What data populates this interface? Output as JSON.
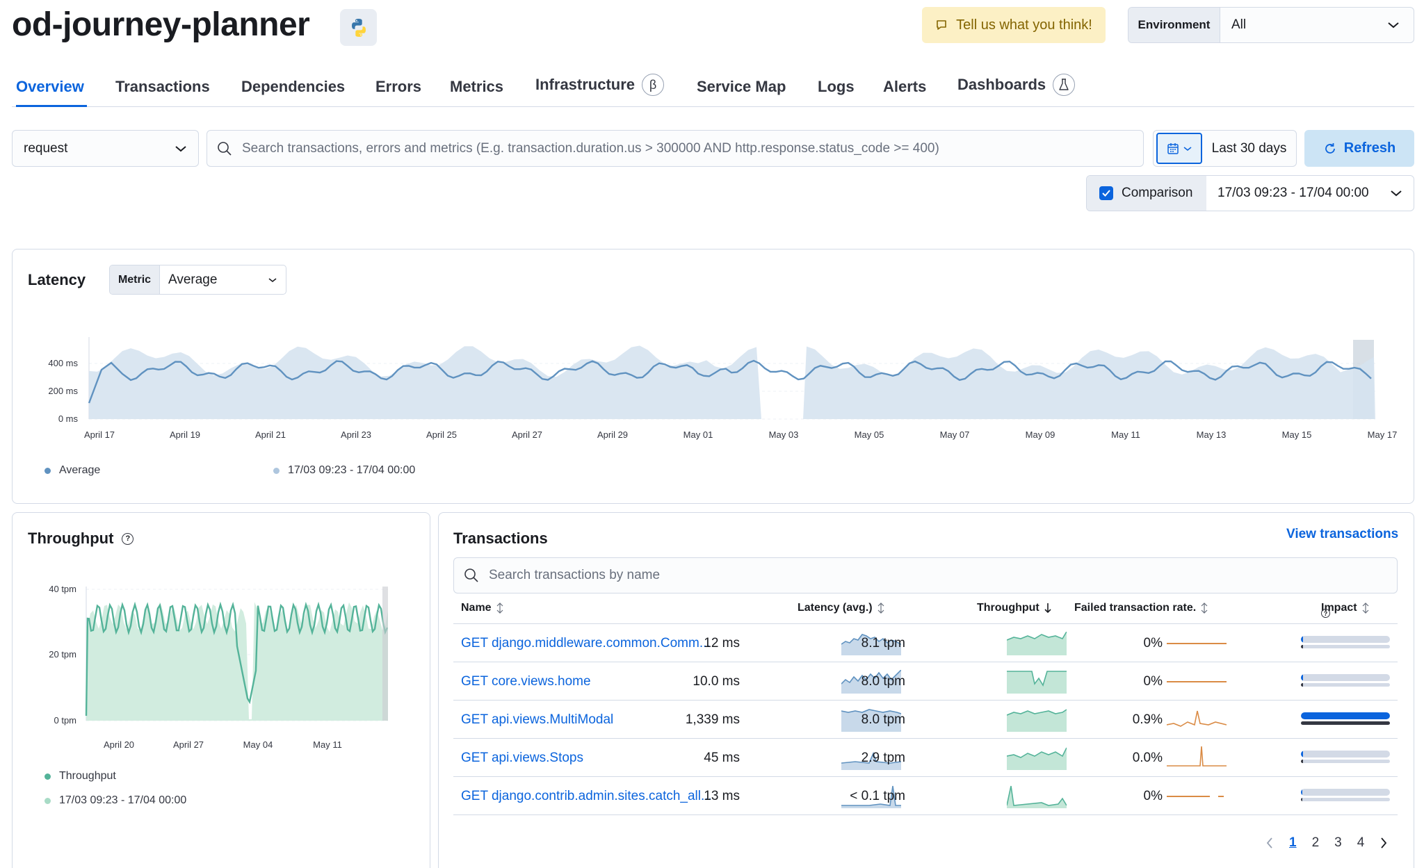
{
  "header": {
    "service_name": "od-journey-planner",
    "python_icon": "python-logo-icon",
    "feedback_label": "Tell us what you think!",
    "environment_label": "Environment",
    "environment_value": "All"
  },
  "tabs": [
    {
      "label": "Overview",
      "active": true
    },
    {
      "label": "Transactions"
    },
    {
      "label": "Dependencies"
    },
    {
      "label": "Errors"
    },
    {
      "label": "Metrics"
    },
    {
      "label": "Infrastructure",
      "badge": "β"
    },
    {
      "label": "Service Map"
    },
    {
      "label": "Logs"
    },
    {
      "label": "Alerts"
    },
    {
      "label": "Dashboards",
      "badge_icon": "flask-icon"
    }
  ],
  "filters": {
    "transaction_type": "request",
    "search_placeholder": "Search transactions, errors and metrics (E.g. transaction.duration.us > 300000 AND http.response.status_code >= 400)",
    "date_range": "Last 30 days",
    "refresh_label": "Refresh",
    "comparison_label": "Comparison",
    "comparison_checked": true,
    "comparison_range": "17/03 09:23 - 17/04 00:00"
  },
  "latency": {
    "title": "Latency",
    "metric_label": "Metric",
    "metric_value": "Average",
    "y_ticks": [
      "0 ms",
      "200 ms",
      "400 ms"
    ],
    "x_ticks": [
      "April 17",
      "April 19",
      "April 21",
      "April 23",
      "April 25",
      "April 27",
      "April 29",
      "May 01",
      "May 03",
      "May 05",
      "May 07",
      "May 09",
      "May 11",
      "May 13",
      "May 15",
      "May 17"
    ],
    "legend": [
      "Average",
      "17/03 09:23 - 17/04 00:00"
    ],
    "colors": {
      "primary": "#6092c0",
      "comparison": "#d6e3f0"
    }
  },
  "throughput": {
    "title": "Throughput",
    "y_ticks": [
      "0 tpm",
      "20 tpm",
      "40 tpm"
    ],
    "x_ticks": [
      "April 20",
      "April 27",
      "May 04",
      "May 11"
    ],
    "legend": [
      "Throughput",
      "17/03 09:23 - 17/04 00:00"
    ],
    "colors": {
      "primary": "#54b399",
      "comparison": "#d1ecdf"
    }
  },
  "transactions": {
    "title": "Transactions",
    "view_link": "View transactions",
    "search_placeholder": "Search transactions by name",
    "columns": {
      "name": "Name",
      "latency": "Latency (avg.)",
      "throughput": "Throughput",
      "failed": "Failed transaction rate.",
      "impact": "Impact"
    },
    "rows": [
      {
        "name": "GET django.middleware.common.Comm...",
        "latency": "12 ms",
        "throughput": "8.1 tpm",
        "failed": "0%",
        "impact": 0.02
      },
      {
        "name": "GET core.views.home",
        "latency": "10.0 ms",
        "throughput": "8.0 tpm",
        "failed": "0%",
        "impact": 0.02
      },
      {
        "name": "GET api.views.MultiModal",
        "latency": "1,339 ms",
        "throughput": "8.0 tpm",
        "failed": "0.9%",
        "impact": 1.0
      },
      {
        "name": "GET api.views.Stops",
        "latency": "45 ms",
        "throughput": "2.9 tpm",
        "failed": "0.0%",
        "impact": 0.02
      },
      {
        "name": "GET django.contrib.admin.sites.catch_all...",
        "latency": "13 ms",
        "throughput": "< 0.1 tpm",
        "failed": "0%",
        "impact": 0.0
      }
    ],
    "pages": [
      "1",
      "2",
      "3",
      "4"
    ],
    "current_page": "1"
  }
}
